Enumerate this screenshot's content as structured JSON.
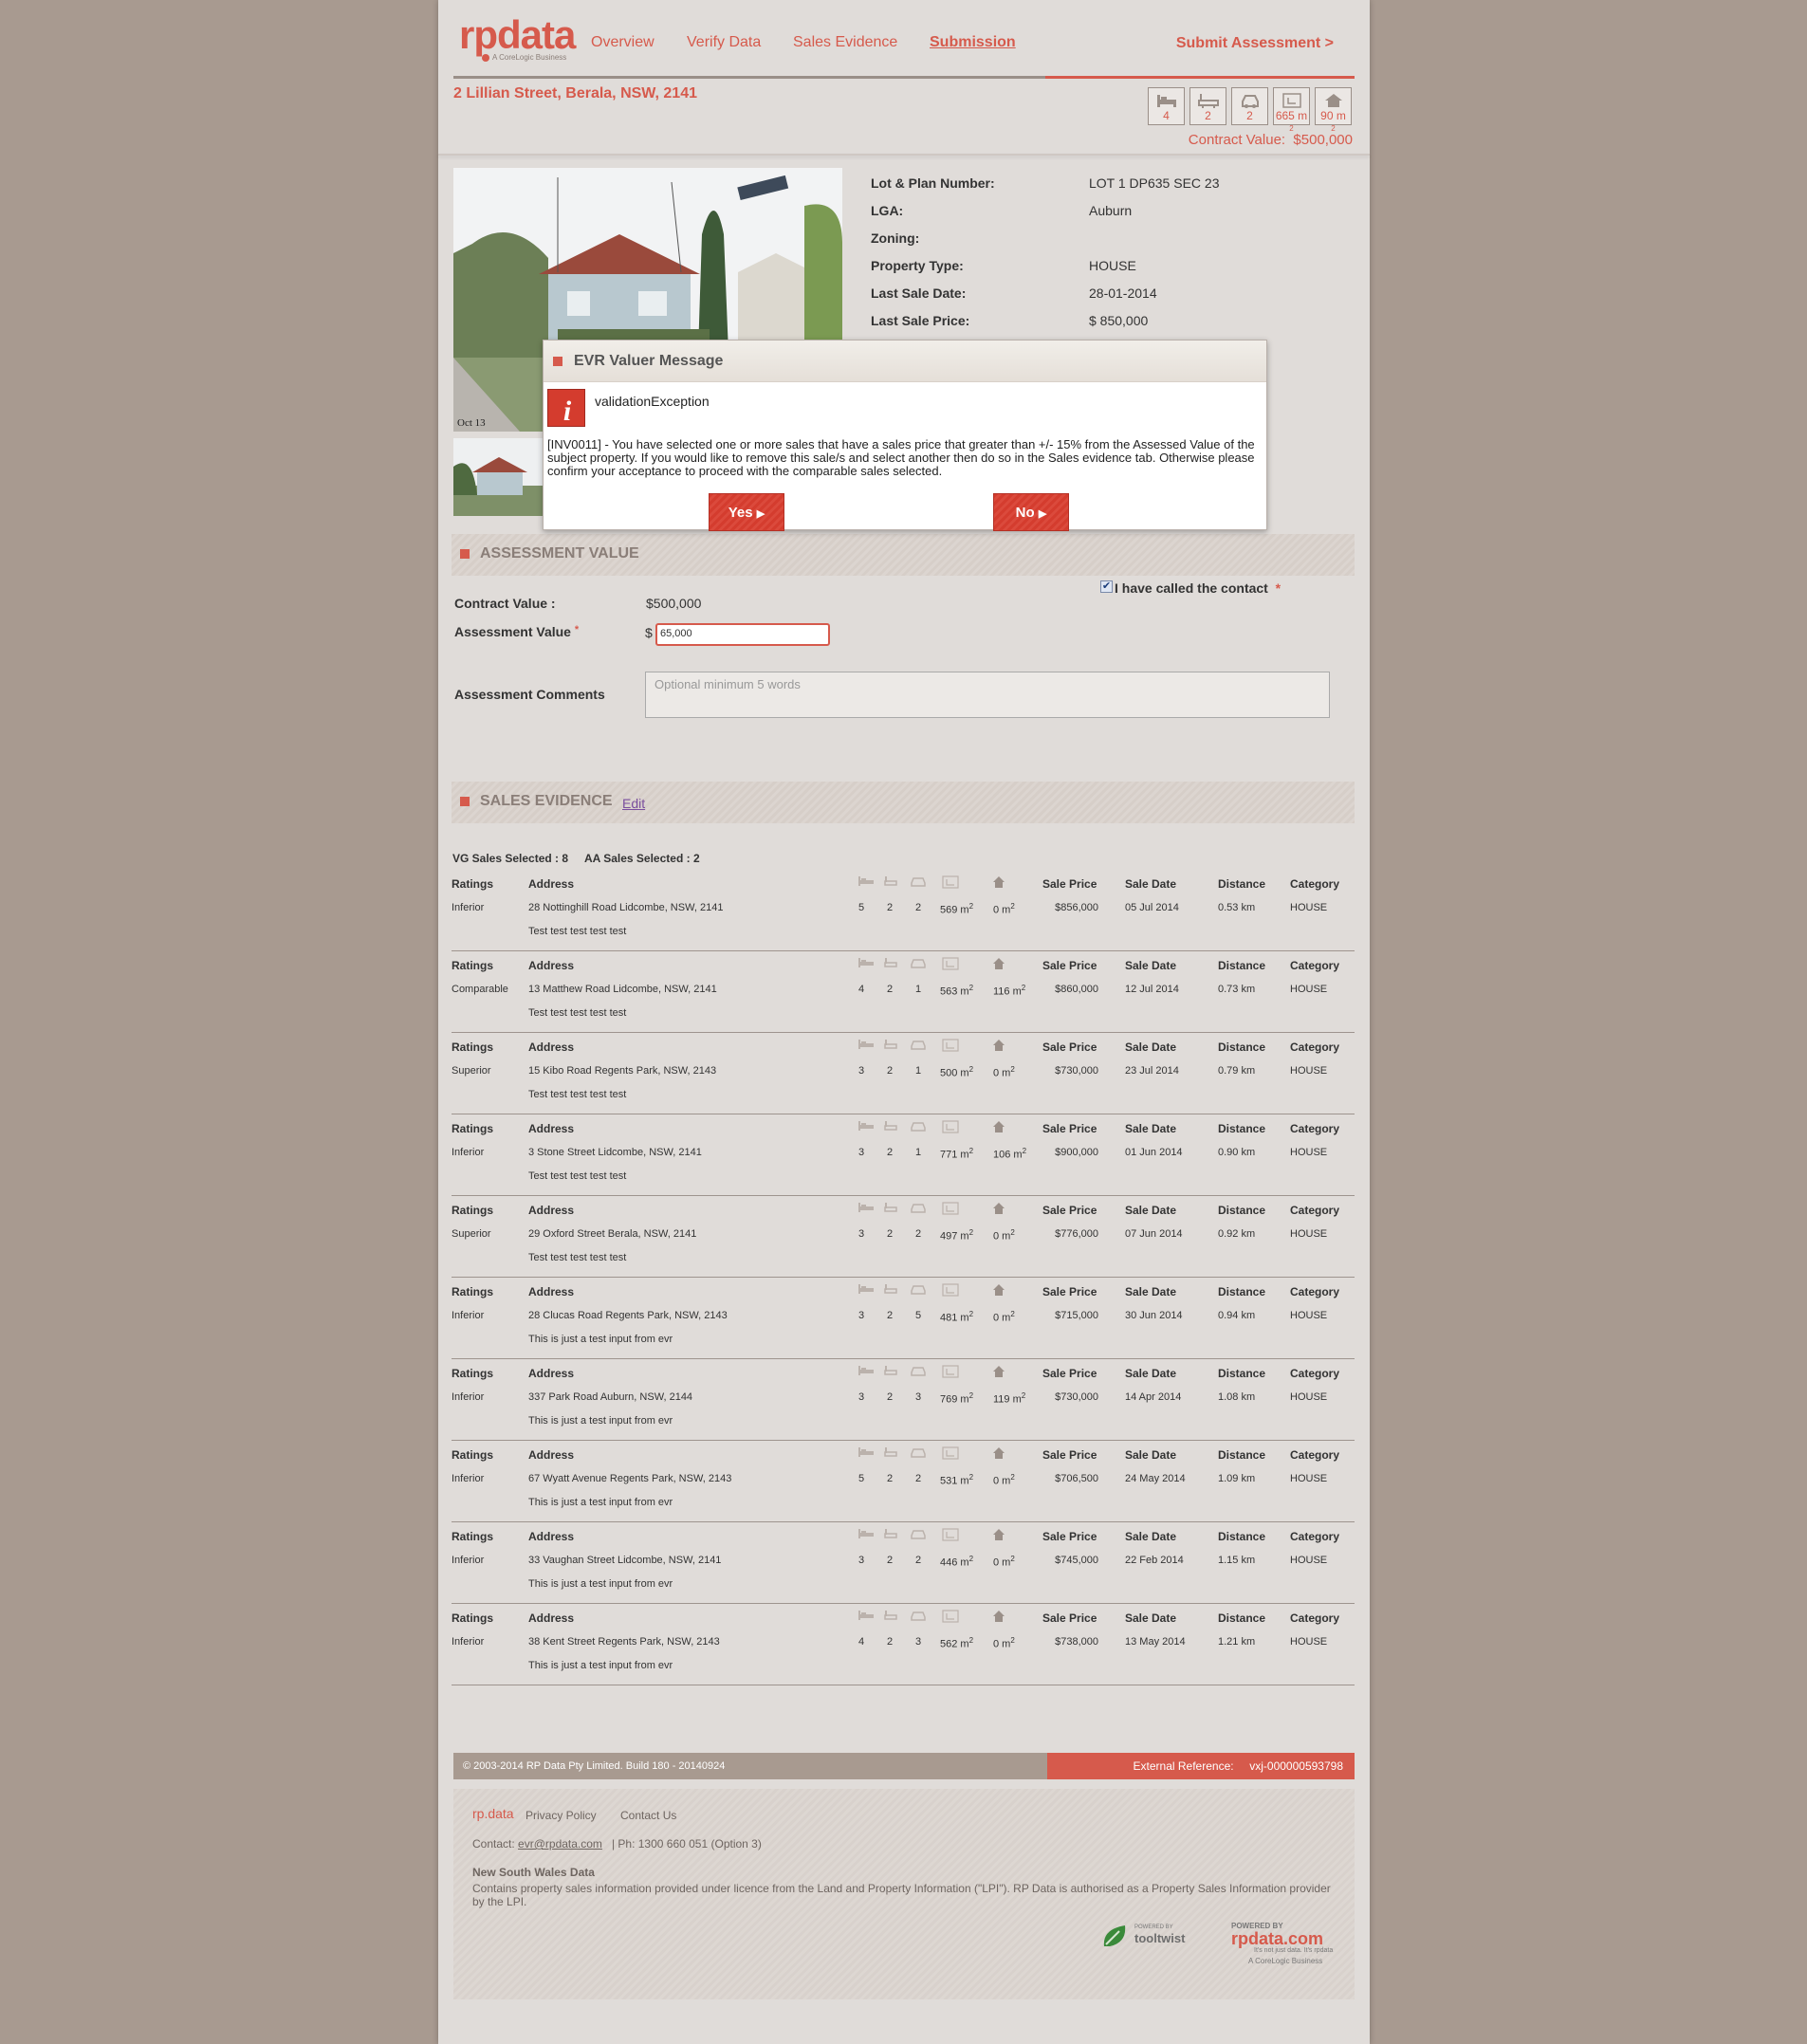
{
  "brand": {
    "logo": "rpdata",
    "tagline": "A CoreLogic Business"
  },
  "nav": [
    {
      "label": "Overview"
    },
    {
      "label": "Verify Data"
    },
    {
      "label": "Sales Evidence"
    },
    {
      "label": "Submission"
    }
  ],
  "submit_label": "Submit Assessment >",
  "property": {
    "address": "2 Lillian Street, Berala, NSW, 2141",
    "beds": "4",
    "baths": "2",
    "cars": "2",
    "land_area": "665 m",
    "floor_area": "90 m",
    "sq": "2",
    "contract_value_label": "Contract Value:",
    "contract_value": "$500,000",
    "photo_caption": "Oct 13"
  },
  "details": [
    {
      "label": "Lot & Plan Number:",
      "value": "LOT 1 DP635 SEC 23"
    },
    {
      "label": "LGA:",
      "value": "Auburn"
    },
    {
      "label": "Zoning:",
      "value": ""
    },
    {
      "label": "Property Type:",
      "value": "HOUSE"
    },
    {
      "label": "Last Sale Date:",
      "value": "28-01-2014"
    },
    {
      "label": "Last Sale Price:",
      "value": "$ 850,000"
    }
  ],
  "modal": {
    "title": "EVR Valuer Message",
    "icon": "info-icon",
    "exception": "validationException",
    "message": "[INV0011] - You have selected one or more sales that have a sales price that greater than +/- 15% from the Assessed Value of the subject property. If you would like to remove this sale/s and select another then do so in the Sales evidence tab. Otherwise please confirm your acceptance to proceed with the comparable sales selected.",
    "yes_label": "Yes",
    "no_label": "No"
  },
  "assessment": {
    "title": "ASSESSMENT VALUE",
    "called_label": "I have called the contact",
    "called_checked": true,
    "contract_label": "Contract Value :",
    "contract_value": "$500,000",
    "assess_label": "Assessment Value",
    "currency": "$",
    "assess_value": "65,000",
    "comments_label": "Assessment Comments",
    "comments_placeholder": "Optional minimum 5 words",
    "required_mark": "*"
  },
  "sales": {
    "title": "SALES EVIDENCE",
    "edit_label": "Edit",
    "vg_label": "VG Sales Selected : 8",
    "aa_label": "AA Sales Selected : 2",
    "headers": {
      "ratings": "Ratings",
      "address": "Address",
      "price": "Sale Price",
      "date": "Sale Date",
      "distance": "Distance",
      "category": "Category"
    },
    "rows": [
      {
        "rating": "Inferior",
        "address": "28 Nottinghill Road Lidcombe, NSW, 2141",
        "beds": "5",
        "baths": "2",
        "cars": "2",
        "land": "569 m",
        "floor": "0 m",
        "price": "$856,000",
        "date": "05 Jul 2014",
        "distance": "0.53 km",
        "category": "HOUSE",
        "comment": "Test test test test test"
      },
      {
        "rating": "Comparable",
        "address": "13 Matthew Road Lidcombe, NSW, 2141",
        "beds": "4",
        "baths": "2",
        "cars": "1",
        "land": "563 m",
        "floor": "116 m",
        "price": "$860,000",
        "date": "12 Jul 2014",
        "distance": "0.73 km",
        "category": "HOUSE",
        "comment": "Test test test test test"
      },
      {
        "rating": "Superior",
        "address": "15 Kibo Road Regents Park, NSW, 2143",
        "beds": "3",
        "baths": "2",
        "cars": "1",
        "land": "500 m",
        "floor": "0 m",
        "price": "$730,000",
        "date": "23 Jul 2014",
        "distance": "0.79 km",
        "category": "HOUSE",
        "comment": "Test test test test test"
      },
      {
        "rating": "Inferior",
        "address": "3 Stone Street Lidcombe, NSW, 2141",
        "beds": "3",
        "baths": "2",
        "cars": "1",
        "land": "771 m",
        "floor": "106 m",
        "price": "$900,000",
        "date": "01 Jun 2014",
        "distance": "0.90 km",
        "category": "HOUSE",
        "comment": "Test test test test test"
      },
      {
        "rating": "Superior",
        "address": "29 Oxford Street Berala, NSW, 2141",
        "beds": "3",
        "baths": "2",
        "cars": "2",
        "land": "497 m",
        "floor": "0 m",
        "price": "$776,000",
        "date": "07 Jun 2014",
        "distance": "0.92 km",
        "category": "HOUSE",
        "comment": "Test test test test test"
      },
      {
        "rating": "Inferior",
        "address": "28 Clucas Road Regents Park, NSW, 2143",
        "beds": "3",
        "baths": "2",
        "cars": "5",
        "land": "481 m",
        "floor": "0 m",
        "price": "$715,000",
        "date": "30 Jun 2014",
        "distance": "0.94 km",
        "category": "HOUSE",
        "comment": "This is just a test input from evr"
      },
      {
        "rating": "Inferior",
        "address": "337 Park Road Auburn, NSW, 2144",
        "beds": "3",
        "baths": "2",
        "cars": "3",
        "land": "769 m",
        "floor": "119 m",
        "price": "$730,000",
        "date": "14 Apr 2014",
        "distance": "1.08 km",
        "category": "HOUSE",
        "comment": "This is just a test input from evr"
      },
      {
        "rating": "Inferior",
        "address": "67 Wyatt Avenue Regents Park, NSW, 2143",
        "beds": "5",
        "baths": "2",
        "cars": "2",
        "land": "531 m",
        "floor": "0 m",
        "price": "$706,500",
        "date": "24 May 2014",
        "distance": "1.09 km",
        "category": "HOUSE",
        "comment": "This is just a test input from evr"
      },
      {
        "rating": "Inferior",
        "address": "33 Vaughan Street Lidcombe, NSW, 2141",
        "beds": "3",
        "baths": "2",
        "cars": "2",
        "land": "446 m",
        "floor": "0 m",
        "price": "$745,000",
        "date": "22 Feb 2014",
        "distance": "1.15 km",
        "category": "HOUSE",
        "comment": "This is just a test input from evr"
      },
      {
        "rating": "Inferior",
        "address": "38 Kent Street Regents Park, NSW, 2143",
        "beds": "4",
        "baths": "2",
        "cars": "3",
        "land": "562 m",
        "floor": "0 m",
        "price": "$738,000",
        "date": "13 May 2014",
        "distance": "1.21 km",
        "category": "HOUSE",
        "comment": "This is just a test input from evr"
      }
    ]
  },
  "footer": {
    "copyright": "© 2003-2014 RP Data Pty Limited.  Build 180 - 20140924",
    "ext_ref_label": "External Reference:",
    "ext_ref": "vxj-000000593798",
    "small_logo": "rp.data",
    "privacy": "Privacy Policy",
    "contact_us": "Contact Us",
    "contact_label": "Contact:",
    "email": "evr@rpdata.com",
    "phone": "|   Ph: 1300 660 051 (Option 3)",
    "nsw_title": "New South Wales Data",
    "nsw_text": "Contains property sales information provided under licence from the Land and Property Information (\"LPI\"). RP Data is authorised as a Property Sales Information provider by the LPI.",
    "tooltwist_small": "POWERED BY",
    "tooltwist": "tooltwist",
    "rp_powered": "POWERED BY",
    "rp_logo": "rpdata.com",
    "rp_slogan": "It's not just data. It's rpdata",
    "rp_corelogic": "A CoreLogic Business"
  },
  "colors": {
    "accent": "#d65a4c",
    "page_bg": "#e0dcd9",
    "body_bg": "#a89a90"
  }
}
